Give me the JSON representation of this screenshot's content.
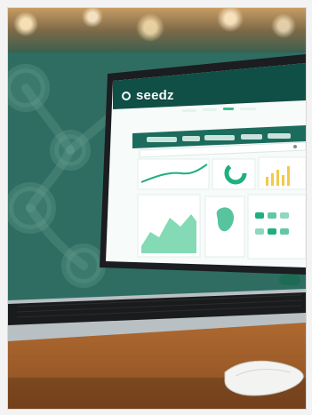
{
  "brand": {
    "name": "seedz",
    "color": "#f5fbff"
  },
  "scene": {
    "subject": "laptop-on-desk",
    "screen_theme_color": "#0f4f45",
    "accent_color": "#1fb07e"
  },
  "ui": {
    "search_placeholder": "",
    "right_chip_label": ""
  }
}
